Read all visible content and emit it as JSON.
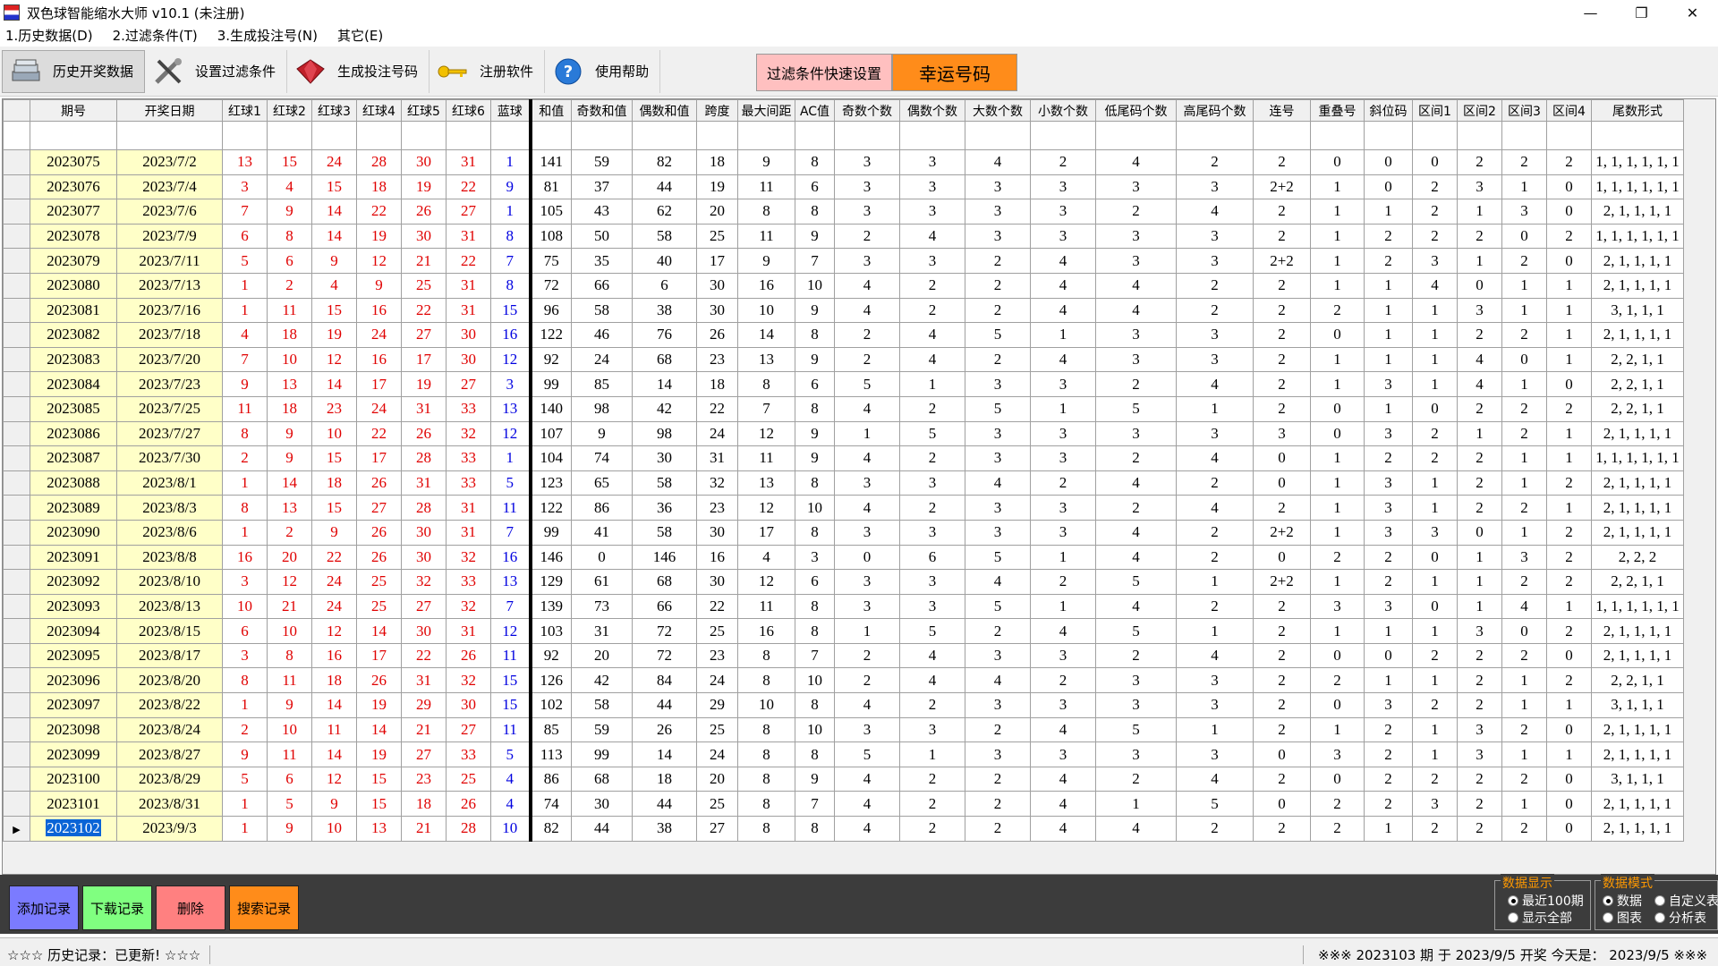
{
  "window": {
    "title": "双色球智能缩水大师 v10.1  (未注册)"
  },
  "menu": [
    "1.历史数据(D)",
    "2.过滤条件(T)",
    "3.生成投注号(N)",
    "其它(E)"
  ],
  "toolbar": {
    "history": "历史开奖数据",
    "filter": "设置过滤条件",
    "generate": "生成投注号码",
    "register": "注册软件",
    "help": "使用帮助",
    "quick_filter": "过滤条件快速设置",
    "lucky": "幸运号码"
  },
  "columns": [
    "期号",
    "开奖日期",
    "红球1",
    "红球2",
    "红球3",
    "红球4",
    "红球5",
    "红球6",
    "蓝球",
    "和值",
    "奇数和值",
    "偶数和值",
    "跨度",
    "最大间距",
    "AC值",
    "奇数个数",
    "偶数个数",
    "大数个数",
    "小数个数",
    "低尾码个数",
    "高尾码个数",
    "连号",
    "重叠号",
    "斜位码",
    "区间1",
    "区间2",
    "区间3",
    "区间4",
    "尾数形式"
  ],
  "rows": [
    [
      "2023075",
      "2023/7/2",
      "13",
      "15",
      "24",
      "28",
      "30",
      "31",
      "1",
      "141",
      "59",
      "82",
      "18",
      "9",
      "8",
      "3",
      "3",
      "4",
      "2",
      "4",
      "2",
      "2",
      "0",
      "0",
      "0",
      "2",
      "2",
      "2",
      "1, 1, 1, 1, 1, 1"
    ],
    [
      "2023076",
      "2023/7/4",
      "3",
      "4",
      "15",
      "18",
      "19",
      "22",
      "9",
      "81",
      "37",
      "44",
      "19",
      "11",
      "6",
      "3",
      "3",
      "3",
      "3",
      "3",
      "3",
      "2+2",
      "1",
      "0",
      "2",
      "3",
      "1",
      "0",
      "1, 1, 1, 1, 1, 1"
    ],
    [
      "2023077",
      "2023/7/6",
      "7",
      "9",
      "14",
      "22",
      "26",
      "27",
      "1",
      "105",
      "43",
      "62",
      "20",
      "8",
      "8",
      "3",
      "3",
      "3",
      "3",
      "2",
      "4",
      "2",
      "1",
      "1",
      "2",
      "1",
      "3",
      "0",
      "2, 1, 1, 1, 1"
    ],
    [
      "2023078",
      "2023/7/9",
      "6",
      "8",
      "14",
      "19",
      "30",
      "31",
      "8",
      "108",
      "50",
      "58",
      "25",
      "11",
      "9",
      "2",
      "4",
      "3",
      "3",
      "3",
      "3",
      "2",
      "1",
      "2",
      "2",
      "2",
      "0",
      "2",
      "1, 1, 1, 1, 1, 1"
    ],
    [
      "2023079",
      "2023/7/11",
      "5",
      "6",
      "9",
      "12",
      "21",
      "22",
      "7",
      "75",
      "35",
      "40",
      "17",
      "9",
      "7",
      "3",
      "3",
      "2",
      "4",
      "3",
      "3",
      "2+2",
      "1",
      "2",
      "3",
      "1",
      "2",
      "0",
      "2, 1, 1, 1, 1"
    ],
    [
      "2023080",
      "2023/7/13",
      "1",
      "2",
      "4",
      "9",
      "25",
      "31",
      "8",
      "72",
      "66",
      "6",
      "30",
      "16",
      "10",
      "4",
      "2",
      "2",
      "4",
      "4",
      "2",
      "2",
      "1",
      "1",
      "4",
      "0",
      "1",
      "1",
      "2, 1, 1, 1, 1"
    ],
    [
      "2023081",
      "2023/7/16",
      "1",
      "11",
      "15",
      "16",
      "22",
      "31",
      "15",
      "96",
      "58",
      "38",
      "30",
      "10",
      "9",
      "4",
      "2",
      "2",
      "4",
      "4",
      "2",
      "2",
      "2",
      "1",
      "1",
      "3",
      "1",
      "1",
      "3, 1, 1, 1"
    ],
    [
      "2023082",
      "2023/7/18",
      "4",
      "18",
      "19",
      "24",
      "27",
      "30",
      "16",
      "122",
      "46",
      "76",
      "26",
      "14",
      "8",
      "2",
      "4",
      "5",
      "1",
      "3",
      "3",
      "2",
      "0",
      "1",
      "1",
      "2",
      "2",
      "1",
      "2, 1, 1, 1, 1"
    ],
    [
      "2023083",
      "2023/7/20",
      "7",
      "10",
      "12",
      "16",
      "17",
      "30",
      "12",
      "92",
      "24",
      "68",
      "23",
      "13",
      "9",
      "2",
      "4",
      "2",
      "4",
      "3",
      "3",
      "2",
      "1",
      "1",
      "1",
      "4",
      "0",
      "1",
      "2, 2, 1, 1"
    ],
    [
      "2023084",
      "2023/7/23",
      "9",
      "13",
      "14",
      "17",
      "19",
      "27",
      "3",
      "99",
      "85",
      "14",
      "18",
      "8",
      "6",
      "5",
      "1",
      "3",
      "3",
      "2",
      "4",
      "2",
      "1",
      "3",
      "1",
      "4",
      "1",
      "0",
      "2, 2, 1, 1"
    ],
    [
      "2023085",
      "2023/7/25",
      "11",
      "18",
      "23",
      "24",
      "31",
      "33",
      "13",
      "140",
      "98",
      "42",
      "22",
      "7",
      "8",
      "4",
      "2",
      "5",
      "1",
      "5",
      "1",
      "2",
      "0",
      "1",
      "0",
      "2",
      "2",
      "2",
      "2, 2, 1, 1"
    ],
    [
      "2023086",
      "2023/7/27",
      "8",
      "9",
      "10",
      "22",
      "26",
      "32",
      "12",
      "107",
      "9",
      "98",
      "24",
      "12",
      "9",
      "1",
      "5",
      "3",
      "3",
      "3",
      "3",
      "3",
      "0",
      "3",
      "2",
      "1",
      "2",
      "1",
      "2, 1, 1, 1, 1"
    ],
    [
      "2023087",
      "2023/7/30",
      "2",
      "9",
      "15",
      "17",
      "28",
      "33",
      "1",
      "104",
      "74",
      "30",
      "31",
      "11",
      "9",
      "4",
      "2",
      "3",
      "3",
      "2",
      "4",
      "0",
      "1",
      "2",
      "2",
      "2",
      "1",
      "1",
      "1, 1, 1, 1, 1, 1"
    ],
    [
      "2023088",
      "2023/8/1",
      "1",
      "14",
      "18",
      "26",
      "31",
      "33",
      "5",
      "123",
      "65",
      "58",
      "32",
      "13",
      "8",
      "3",
      "3",
      "4",
      "2",
      "4",
      "2",
      "0",
      "1",
      "3",
      "1",
      "2",
      "1",
      "2",
      "2, 1, 1, 1, 1"
    ],
    [
      "2023089",
      "2023/8/3",
      "8",
      "13",
      "15",
      "27",
      "28",
      "31",
      "11",
      "122",
      "86",
      "36",
      "23",
      "12",
      "10",
      "4",
      "2",
      "3",
      "3",
      "2",
      "4",
      "2",
      "1",
      "3",
      "1",
      "2",
      "2",
      "1",
      "2, 1, 1, 1, 1"
    ],
    [
      "2023090",
      "2023/8/6",
      "1",
      "2",
      "9",
      "26",
      "30",
      "31",
      "7",
      "99",
      "41",
      "58",
      "30",
      "17",
      "8",
      "3",
      "3",
      "3",
      "3",
      "4",
      "2",
      "2+2",
      "1",
      "3",
      "3",
      "0",
      "1",
      "2",
      "2, 1, 1, 1, 1"
    ],
    [
      "2023091",
      "2023/8/8",
      "16",
      "20",
      "22",
      "26",
      "30",
      "32",
      "16",
      "146",
      "0",
      "146",
      "16",
      "4",
      "3",
      "0",
      "6",
      "5",
      "1",
      "4",
      "2",
      "0",
      "2",
      "2",
      "0",
      "1",
      "3",
      "2",
      "2, 2, 2"
    ],
    [
      "2023092",
      "2023/8/10",
      "3",
      "12",
      "24",
      "25",
      "32",
      "33",
      "13",
      "129",
      "61",
      "68",
      "30",
      "12",
      "6",
      "3",
      "3",
      "4",
      "2",
      "5",
      "1",
      "2+2",
      "1",
      "2",
      "1",
      "1",
      "2",
      "2",
      "2, 2, 1, 1"
    ],
    [
      "2023093",
      "2023/8/13",
      "10",
      "21",
      "24",
      "25",
      "27",
      "32",
      "7",
      "139",
      "73",
      "66",
      "22",
      "11",
      "8",
      "3",
      "3",
      "5",
      "1",
      "4",
      "2",
      "2",
      "3",
      "3",
      "0",
      "1",
      "4",
      "1",
      "1, 1, 1, 1, 1, 1"
    ],
    [
      "2023094",
      "2023/8/15",
      "6",
      "10",
      "12",
      "14",
      "30",
      "31",
      "12",
      "103",
      "31",
      "72",
      "25",
      "16",
      "8",
      "1",
      "5",
      "2",
      "4",
      "5",
      "1",
      "2",
      "1",
      "1",
      "1",
      "3",
      "0",
      "2",
      "2, 1, 1, 1, 1"
    ],
    [
      "2023095",
      "2023/8/17",
      "3",
      "8",
      "16",
      "17",
      "22",
      "26",
      "11",
      "92",
      "20",
      "72",
      "23",
      "8",
      "7",
      "2",
      "4",
      "3",
      "3",
      "2",
      "4",
      "2",
      "0",
      "0",
      "2",
      "2",
      "2",
      "0",
      "2, 1, 1, 1, 1"
    ],
    [
      "2023096",
      "2023/8/20",
      "8",
      "11",
      "18",
      "26",
      "31",
      "32",
      "15",
      "126",
      "42",
      "84",
      "24",
      "8",
      "10",
      "2",
      "4",
      "4",
      "2",
      "3",
      "3",
      "2",
      "2",
      "1",
      "1",
      "2",
      "1",
      "2",
      "2, 2, 1, 1"
    ],
    [
      "2023097",
      "2023/8/22",
      "1",
      "9",
      "14",
      "19",
      "29",
      "30",
      "15",
      "102",
      "58",
      "44",
      "29",
      "10",
      "8",
      "4",
      "2",
      "3",
      "3",
      "3",
      "3",
      "2",
      "0",
      "3",
      "2",
      "2",
      "1",
      "1",
      "3, 1, 1, 1"
    ],
    [
      "2023098",
      "2023/8/24",
      "2",
      "10",
      "11",
      "14",
      "21",
      "27",
      "11",
      "85",
      "59",
      "26",
      "25",
      "8",
      "10",
      "3",
      "3",
      "2",
      "4",
      "5",
      "1",
      "2",
      "1",
      "2",
      "1",
      "3",
      "2",
      "0",
      "2, 1, 1, 1, 1"
    ],
    [
      "2023099",
      "2023/8/27",
      "9",
      "11",
      "14",
      "19",
      "27",
      "33",
      "5",
      "113",
      "99",
      "14",
      "24",
      "8",
      "8",
      "5",
      "1",
      "3",
      "3",
      "3",
      "3",
      "0",
      "3",
      "2",
      "1",
      "3",
      "1",
      "1",
      "2, 1, 1, 1, 1"
    ],
    [
      "2023100",
      "2023/8/29",
      "5",
      "6",
      "12",
      "15",
      "23",
      "25",
      "4",
      "86",
      "68",
      "18",
      "20",
      "8",
      "9",
      "4",
      "2",
      "2",
      "4",
      "2",
      "4",
      "2",
      "0",
      "2",
      "2",
      "2",
      "2",
      "0",
      "3, 1, 1, 1"
    ],
    [
      "2023101",
      "2023/8/31",
      "1",
      "5",
      "9",
      "15",
      "18",
      "26",
      "4",
      "74",
      "30",
      "44",
      "25",
      "8",
      "7",
      "4",
      "2",
      "2",
      "4",
      "1",
      "5",
      "0",
      "2",
      "2",
      "3",
      "2",
      "1",
      "0",
      "2, 1, 1, 1, 1"
    ],
    [
      "2023102",
      "2023/9/3",
      "1",
      "9",
      "10",
      "13",
      "21",
      "28",
      "10",
      "82",
      "44",
      "38",
      "27",
      "8",
      "8",
      "4",
      "2",
      "2",
      "4",
      "4",
      "2",
      "2",
      "2",
      "1",
      "2",
      "2",
      "2",
      "0",
      "2, 1, 1, 1, 1"
    ]
  ],
  "bottom_buttons": {
    "add": "添加记录",
    "download": "下载记录",
    "delete": "删除",
    "search": "搜索记录"
  },
  "data_display": {
    "title": "数据显示",
    "opt1": "最近100期",
    "opt2": "显示全部"
  },
  "data_mode": {
    "title": "数据模式",
    "opt1": "数据",
    "opt2": "自定义表",
    "opt3": "图表",
    "opt4": "分析表"
  },
  "status": {
    "left": "☆☆☆  历史记录：已更新!  ☆☆☆",
    "right": "※※※  2023103 期 于 2023/9/5 开奖    今天是：  2023/9/5 ※※※"
  },
  "colors": {
    "period_bg": "#ffffc8",
    "red_ball": "#e00000",
    "blue_ball": "#0000e0",
    "lucky_btn": "#ff8c1a",
    "quick_btn": "#ffc0c0"
  }
}
